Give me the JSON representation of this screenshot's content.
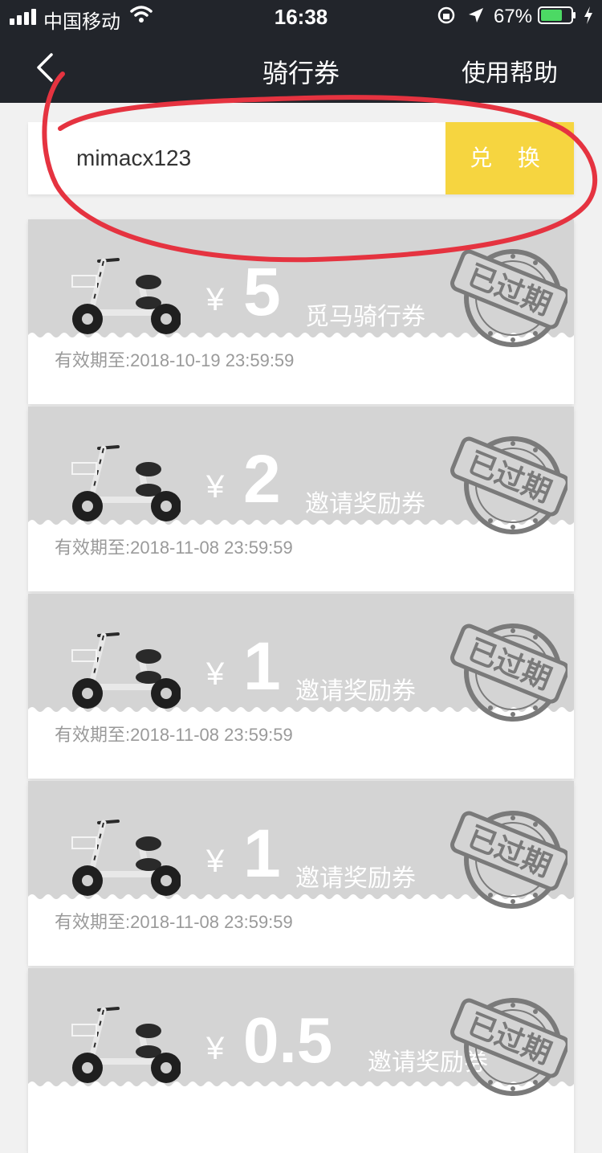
{
  "status_bar": {
    "carrier": "中国移动",
    "time": "16:38",
    "battery": "67%"
  },
  "nav": {
    "title": "骑行券",
    "help": "使用帮助"
  },
  "redeem": {
    "code_value": "mimacx123",
    "button_label": "兑 换"
  },
  "coupons": [
    {
      "currency": "¥",
      "amount": "5",
      "name": "觅马骑行券",
      "expiry": "有效期至:2018-10-19 23:59:59",
      "stamp": "已过期"
    },
    {
      "currency": "¥",
      "amount": "2",
      "name": "邀请奖励券",
      "expiry": "有效期至:2018-11-08 23:59:59",
      "stamp": "已过期"
    },
    {
      "currency": "¥",
      "amount": "1",
      "name": "邀请奖励券",
      "expiry": "有效期至:2018-11-08 23:59:59",
      "stamp": "已过期"
    },
    {
      "currency": "¥",
      "amount": "1",
      "name": "邀请奖励券",
      "expiry": "有效期至:2018-11-08 23:59:59",
      "stamp": "已过期"
    },
    {
      "currency": "¥",
      "amount": "0.5",
      "name": "邀请奖励券",
      "expiry": "",
      "stamp": "已过期"
    }
  ],
  "colors": {
    "nav_bg": "#22252b",
    "accent_yellow": "#f6d540",
    "coupon_gray": "#d4d4d4",
    "annotation_red": "#e53340"
  }
}
